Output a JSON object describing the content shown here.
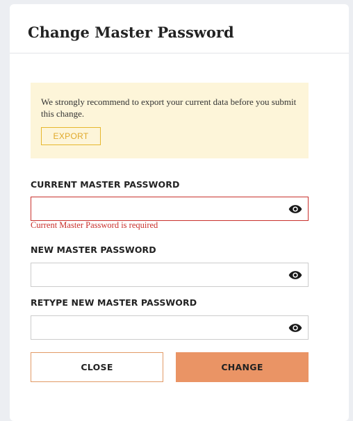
{
  "dialog": {
    "title": "Change Master Password"
  },
  "warning": {
    "text": "We strongly recommend to export your current data before you submit this change.",
    "export_label": "EXPORT"
  },
  "fields": {
    "current": {
      "label": "CURRENT MASTER PASSWORD",
      "value": "",
      "error": "Current Master Password is required"
    },
    "new": {
      "label": "NEW MASTER PASSWORD",
      "value": ""
    },
    "retype": {
      "label": "RETYPE NEW MASTER PASSWORD",
      "value": ""
    }
  },
  "actions": {
    "close_label": "CLOSE",
    "change_label": "CHANGE"
  },
  "colors": {
    "accent": "#ea9465",
    "error": "#c9302c",
    "warning_bg": "#fdf5d9",
    "warning_accent": "#e0a92a"
  },
  "icons": {
    "show_password": "eye-icon"
  }
}
